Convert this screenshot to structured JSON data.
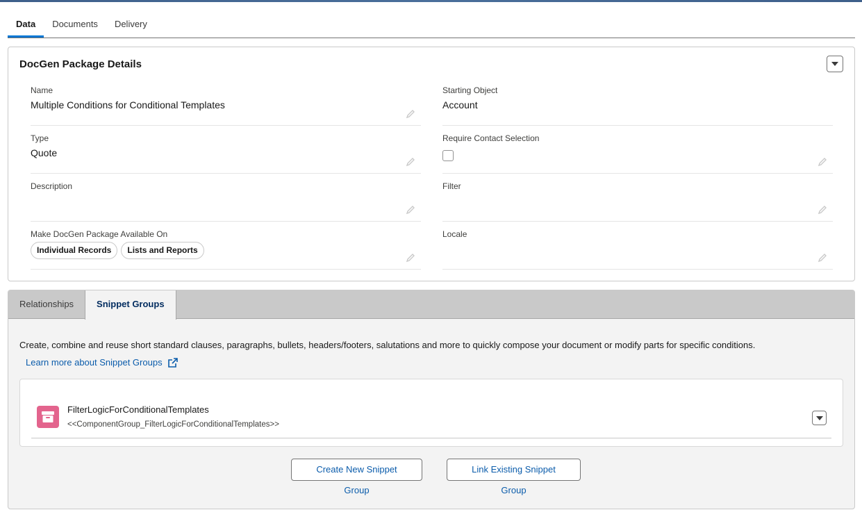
{
  "top_tabs": [
    {
      "label": "Data",
      "active": true
    },
    {
      "label": "Documents",
      "active": false
    },
    {
      "label": "Delivery",
      "active": false
    }
  ],
  "details": {
    "title": "DocGen Package Details",
    "fields": {
      "name": {
        "label": "Name",
        "value": "Multiple Conditions for Conditional Templates"
      },
      "starting_object": {
        "label": "Starting Object",
        "value": "Account"
      },
      "type": {
        "label": "Type",
        "value": "Quote"
      },
      "require_contact": {
        "label": "Require Contact Selection",
        "checked": false
      },
      "description": {
        "label": "Description",
        "value": ""
      },
      "filter": {
        "label": "Filter",
        "value": ""
      },
      "available_on": {
        "label": "Make DocGen Package Available On",
        "pills": [
          "Individual Records",
          "Lists and Reports"
        ]
      },
      "locale": {
        "label": "Locale",
        "value": ""
      }
    }
  },
  "snippet": {
    "tabs": [
      {
        "label": "Relationships",
        "active": false
      },
      {
        "label": "Snippet Groups",
        "active": true
      }
    ],
    "description": "Create, combine and reuse short standard clauses, paragraphs, bullets, headers/footers, salutations and more to quickly compose your document or modify parts for specific conditions.",
    "learn_link": "Learn more about Snippet Groups",
    "group": {
      "name": "FilterLogicForConditionalTemplates",
      "tag": "<<ComponentGroup_FilterLogicForConditionalTemplates>>",
      "icon": "archive-icon",
      "icon_color": "#e3648d"
    },
    "create_button": "Create New Snippet Group",
    "link_button": "Link Existing Snippet Group"
  },
  "colors": {
    "accent": "#0176d3",
    "link": "#0b5cab",
    "active_subtab": "#032d60"
  }
}
